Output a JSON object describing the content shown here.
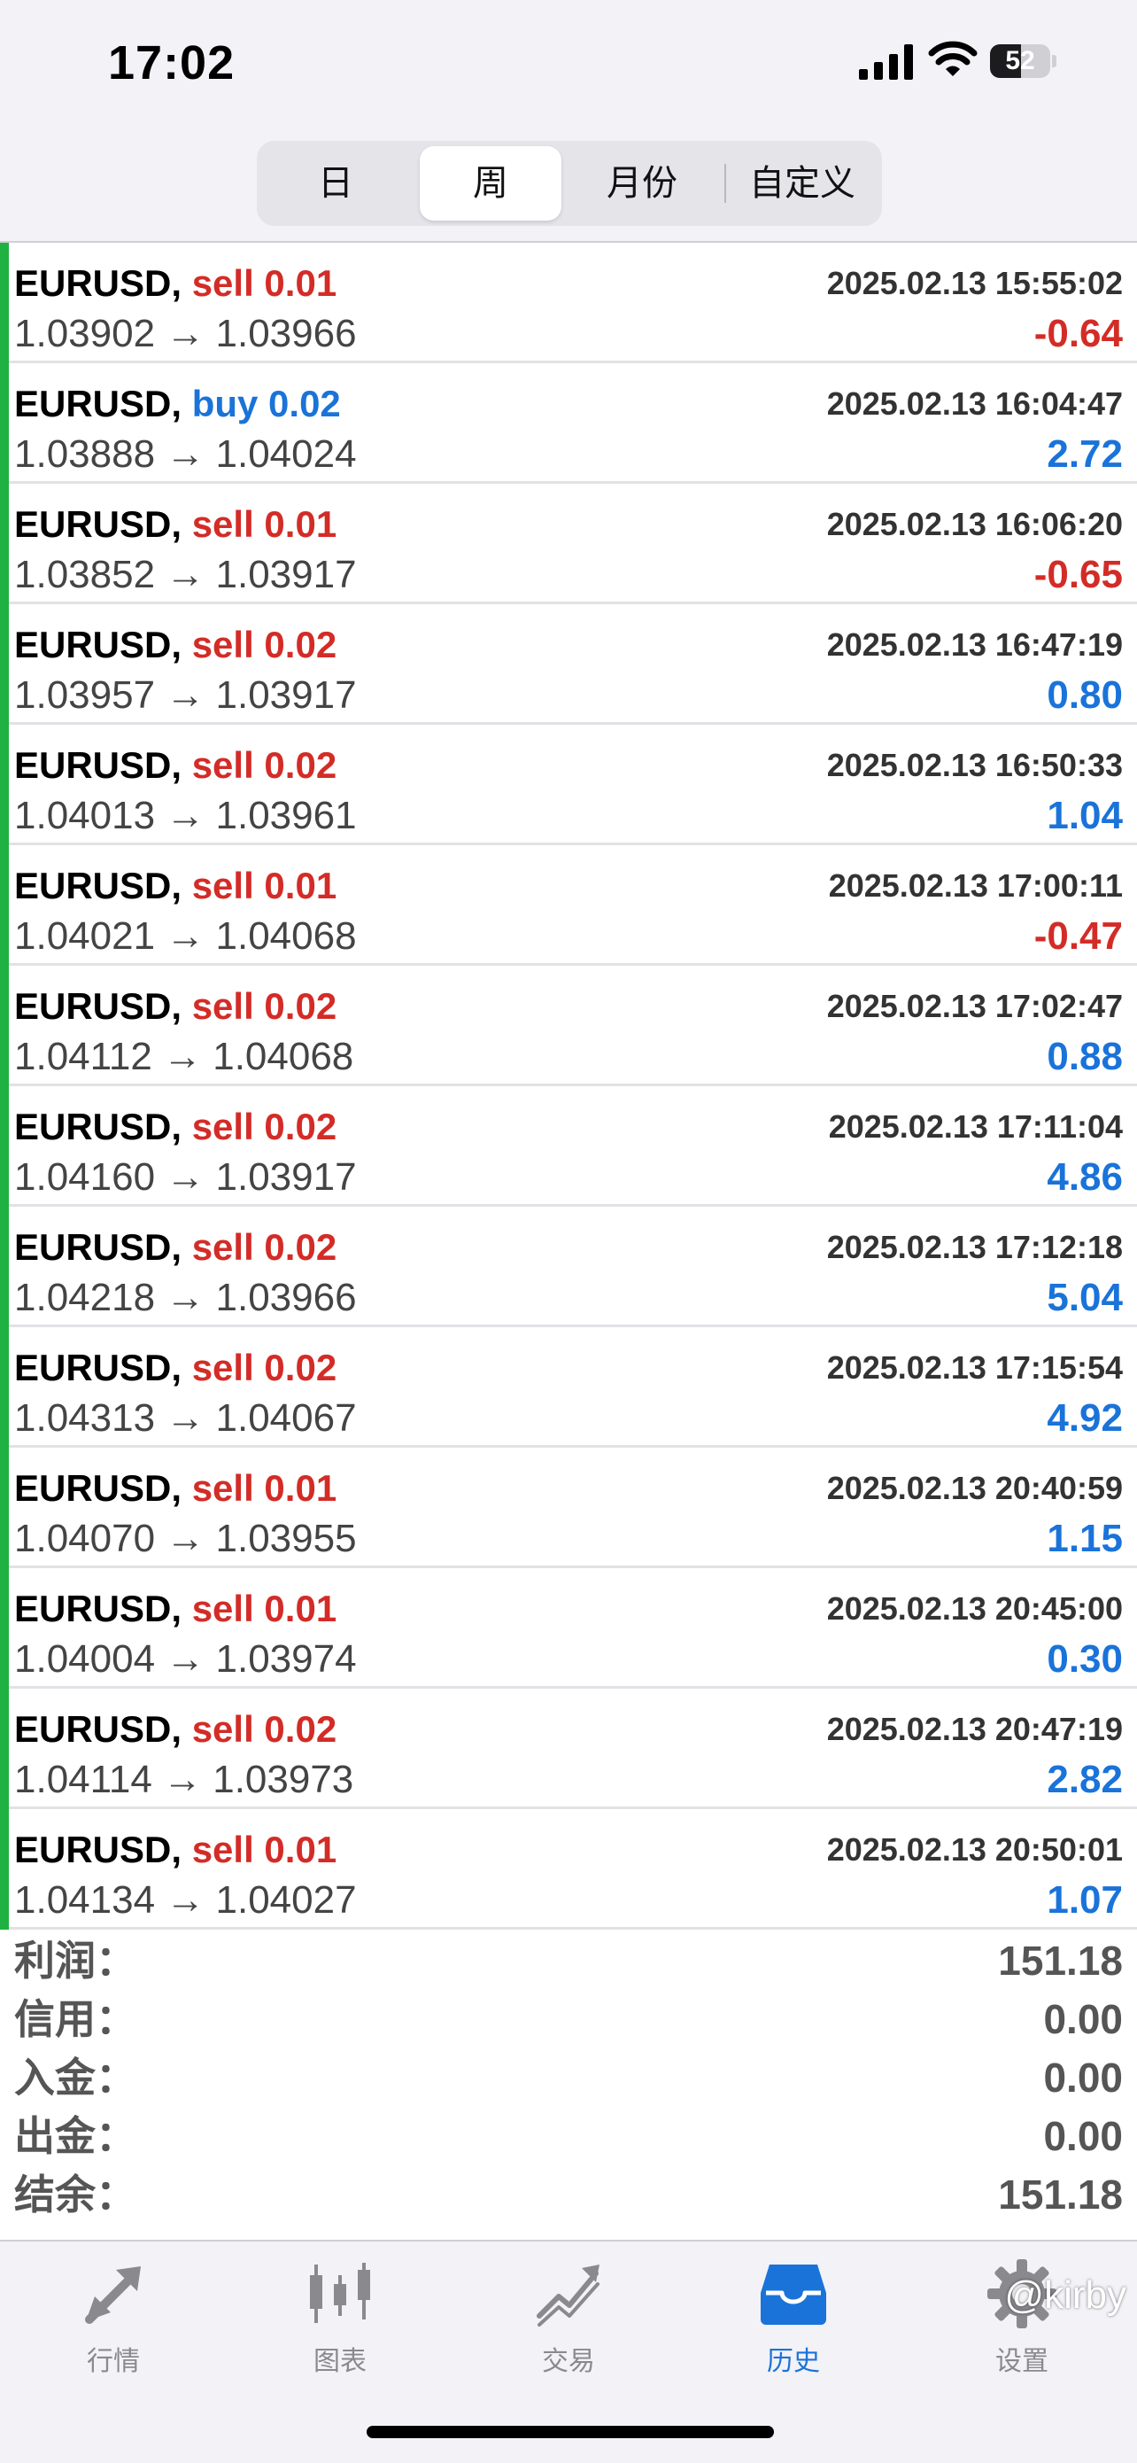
{
  "status_bar": {
    "time": "17:02",
    "battery": "52",
    "battery_level": 0.52
  },
  "period_tabs": [
    {
      "label": "日",
      "active": false
    },
    {
      "label": "周",
      "active": true
    },
    {
      "label": "月份",
      "active": false
    },
    {
      "label": "自定义",
      "active": false
    }
  ],
  "deals": [
    {
      "symbol": "EURUSD,",
      "side": "sell",
      "volume": "0.01",
      "time": "2025.02.13 15:55:02",
      "open_price": "1.03902",
      "close_price": "1.03966",
      "profit": "-0.64"
    },
    {
      "symbol": "EURUSD,",
      "side": "buy",
      "volume": "0.02",
      "time": "2025.02.13 16:04:47",
      "open_price": "1.03888",
      "close_price": "1.04024",
      "profit": "2.72"
    },
    {
      "symbol": "EURUSD,",
      "side": "sell",
      "volume": "0.01",
      "time": "2025.02.13 16:06:20",
      "open_price": "1.03852",
      "close_price": "1.03917",
      "profit": "-0.65"
    },
    {
      "symbol": "EURUSD,",
      "side": "sell",
      "volume": "0.02",
      "time": "2025.02.13 16:47:19",
      "open_price": "1.03957",
      "close_price": "1.03917",
      "profit": "0.80"
    },
    {
      "symbol": "EURUSD,",
      "side": "sell",
      "volume": "0.02",
      "time": "2025.02.13 16:50:33",
      "open_price": "1.04013",
      "close_price": "1.03961",
      "profit": "1.04"
    },
    {
      "symbol": "EURUSD,",
      "side": "sell",
      "volume": "0.01",
      "time": "2025.02.13 17:00:11",
      "open_price": "1.04021",
      "close_price": "1.04068",
      "profit": "-0.47"
    },
    {
      "symbol": "EURUSD,",
      "side": "sell",
      "volume": "0.02",
      "time": "2025.02.13 17:02:47",
      "open_price": "1.04112",
      "close_price": "1.04068",
      "profit": "0.88"
    },
    {
      "symbol": "EURUSD,",
      "side": "sell",
      "volume": "0.02",
      "time": "2025.02.13 17:11:04",
      "open_price": "1.04160",
      "close_price": "1.03917",
      "profit": "4.86"
    },
    {
      "symbol": "EURUSD,",
      "side": "sell",
      "volume": "0.02",
      "time": "2025.02.13 17:12:18",
      "open_price": "1.04218",
      "close_price": "1.03966",
      "profit": "5.04"
    },
    {
      "symbol": "EURUSD,",
      "side": "sell",
      "volume": "0.02",
      "time": "2025.02.13 17:15:54",
      "open_price": "1.04313",
      "close_price": "1.04067",
      "profit": "4.92"
    },
    {
      "symbol": "EURUSD,",
      "side": "sell",
      "volume": "0.01",
      "time": "2025.02.13 20:40:59",
      "open_price": "1.04070",
      "close_price": "1.03955",
      "profit": "1.15"
    },
    {
      "symbol": "EURUSD,",
      "side": "sell",
      "volume": "0.01",
      "time": "2025.02.13 20:45:00",
      "open_price": "1.04004",
      "close_price": "1.03974",
      "profit": "0.30"
    },
    {
      "symbol": "EURUSD,",
      "side": "sell",
      "volume": "0.02",
      "time": "2025.02.13 20:47:19",
      "open_price": "1.04114",
      "close_price": "1.03973",
      "profit": "2.82"
    },
    {
      "symbol": "EURUSD,",
      "side": "sell",
      "volume": "0.01",
      "time": "2025.02.13 20:50:01",
      "open_price": "1.04134",
      "close_price": "1.04027",
      "profit": "1.07"
    }
  ],
  "arrow": "→",
  "summary": [
    {
      "label": "利润：",
      "value": "151.18"
    },
    {
      "label": "信用：",
      "value": "0.00"
    },
    {
      "label": "入金：",
      "value": "0.00"
    },
    {
      "label": "出金：",
      "value": "0.00"
    },
    {
      "label": "结余：",
      "value": "151.18"
    }
  ],
  "tab_bar": [
    {
      "label": "行情",
      "icon": "quotes-arrows-icon",
      "active": false
    },
    {
      "label": "图表",
      "icon": "candlestick-chart-icon",
      "active": false
    },
    {
      "label": "交易",
      "icon": "trade-chart-icon",
      "active": false
    },
    {
      "label": "历史",
      "icon": "history-inbox-icon",
      "active": true
    },
    {
      "label": "设置",
      "icon": "gear-icon",
      "active": false
    }
  ],
  "watermark": "@kirby",
  "colors": {
    "sell": "#d32c27",
    "buy": "#1a73d9",
    "loss": "#d32c27",
    "gain": "#1a73d9",
    "accent_bar": "#1fb141",
    "tab_active": "#1a73d9",
    "tab_inactive": "#8a8a8e"
  }
}
